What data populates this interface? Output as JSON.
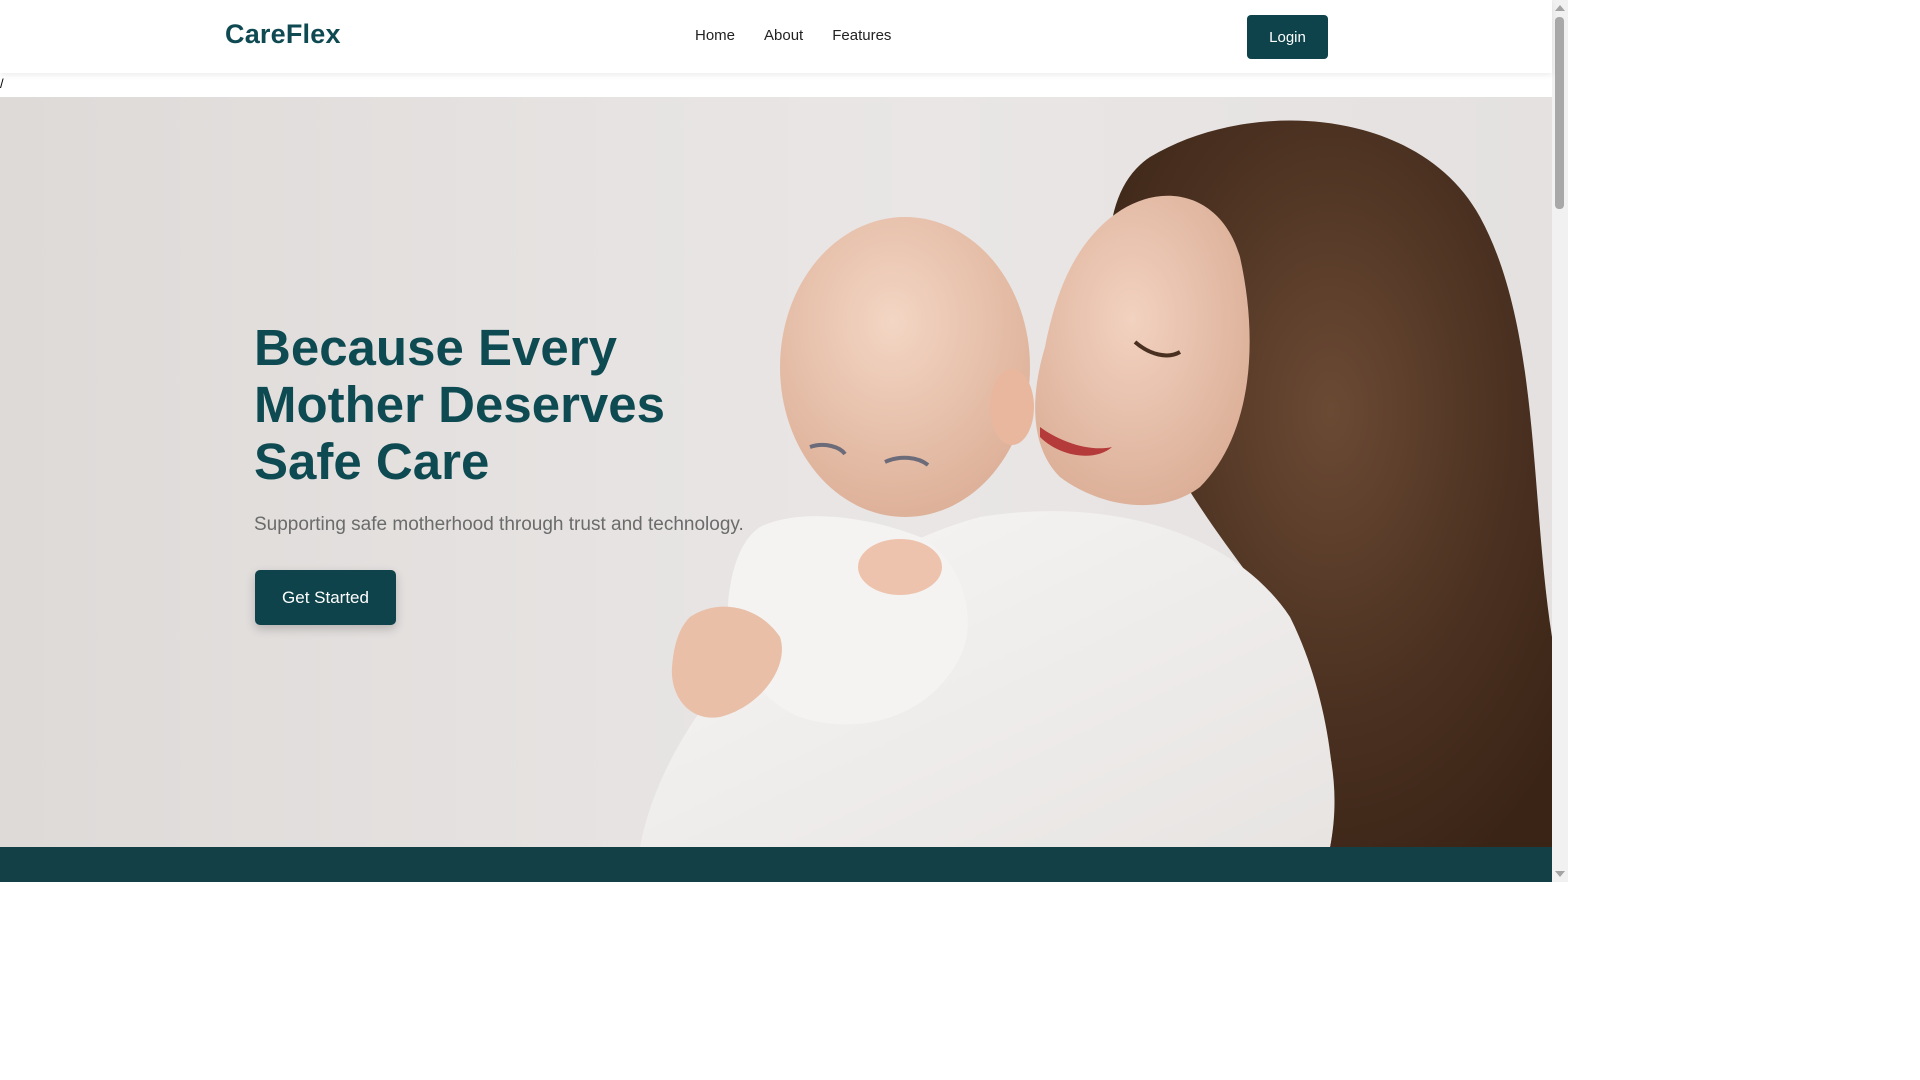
{
  "header": {
    "logo": "CareFlex",
    "nav": [
      "Home",
      "About",
      "Features"
    ],
    "login_label": "Login"
  },
  "stray_text": "/",
  "hero": {
    "title_lines": [
      "Because Every",
      "Mother Deserves",
      "Safe Care"
    ],
    "subtitle": "Supporting safe motherhood through trust and technology.",
    "cta_label": "Get Started"
  },
  "colors": {
    "brand": "#0e434b",
    "title": "#0e4a52",
    "footer_band": "#133f46"
  }
}
